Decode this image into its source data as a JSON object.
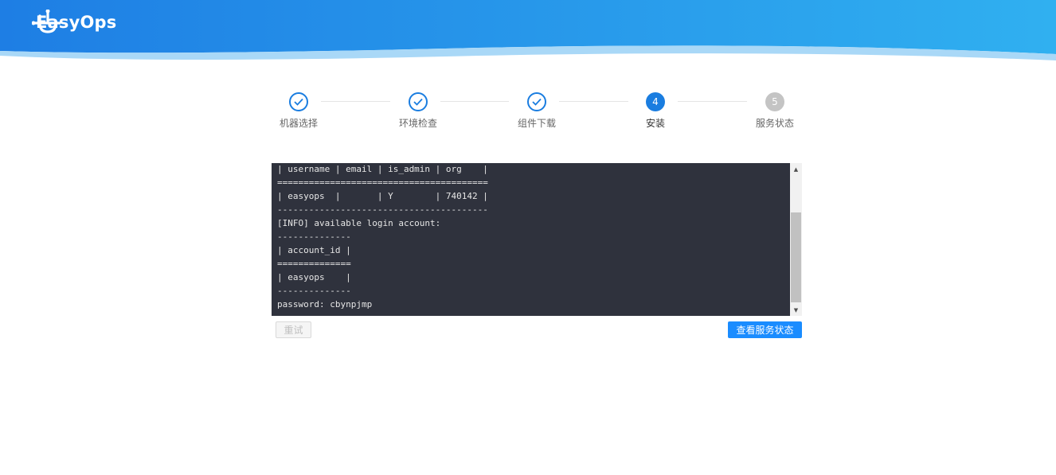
{
  "brand": {
    "name": "EasyOps"
  },
  "steps": [
    {
      "label": "机器选择",
      "status": "done"
    },
    {
      "label": "环境检查",
      "status": "done"
    },
    {
      "label": "组件下载",
      "status": "done"
    },
    {
      "label": "安装",
      "status": "active",
      "number": "4"
    },
    {
      "label": "服务状态",
      "status": "wait",
      "number": "5"
    }
  ],
  "console": {
    "lines": [
      "| username | email | is_admin | org    |",
      "========================================",
      "| easyops  |       | Y        | 740142 |",
      "----------------------------------------",
      "[INFO] available login account:",
      "--------------",
      "| account_id |",
      "==============",
      "| easyops    |",
      "--------------",
      "password: cbynpjmp"
    ]
  },
  "actions": {
    "retry_label": "重试",
    "view_status_label": "查看服务状态"
  },
  "colors": {
    "header_start": "#1e7ee4",
    "header_end": "#30b0f0",
    "primary": "#1a7de0",
    "console_bg": "#2f323d"
  }
}
